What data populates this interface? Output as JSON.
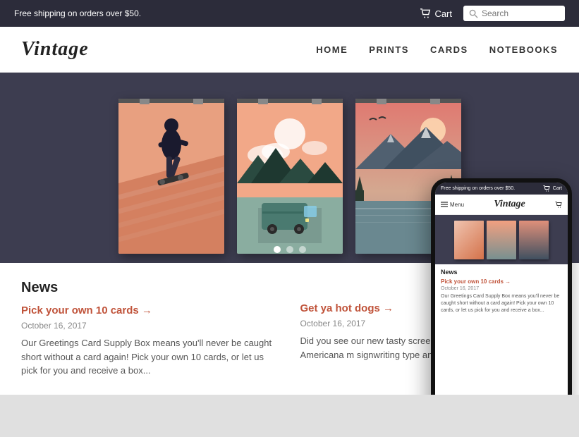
{
  "announcement": {
    "text": "Free shipping on orders over $50.",
    "cart_label": "Cart",
    "search_placeholder": "Search"
  },
  "header": {
    "logo": "Vintage",
    "nav": [
      {
        "label": "HOME",
        "id": "home"
      },
      {
        "label": "PRINTS",
        "id": "prints"
      },
      {
        "label": "CARDS",
        "id": "cards"
      },
      {
        "label": "NOTEBOOKS",
        "id": "notebooks"
      }
    ]
  },
  "hero": {
    "dots": [
      {
        "active": true
      },
      {
        "active": false
      },
      {
        "active": false
      }
    ]
  },
  "news": [
    {
      "heading": "News",
      "link": "Pick your own 10 cards →",
      "date": "October 16, 2017",
      "text": "Our Greetings Card Supply Box means you'll never be caught short without a card again! Pick your own 10 cards, or let us pick for you and receive a box..."
    },
    {
      "link": "Get ya hot dogs →",
      "date": "October 16, 2017",
      "text": "Did you see our new tasty screen love of mid century Americana m signwriting type and our studio b..."
    }
  ],
  "mobile": {
    "topbar_text": "Free shipping on orders over $50.",
    "cart_label": "Cart",
    "menu_label": "Menu",
    "logo": "Vintage",
    "news_heading": "News",
    "news_link": "Pick your own 10 cards →",
    "news_date": "October 16, 2017",
    "news_text": "Our Greetings Card Supply Box means you'll never be caught short without a card again! Pick your own 10 cards, or let us pick for you and receive a box..."
  }
}
